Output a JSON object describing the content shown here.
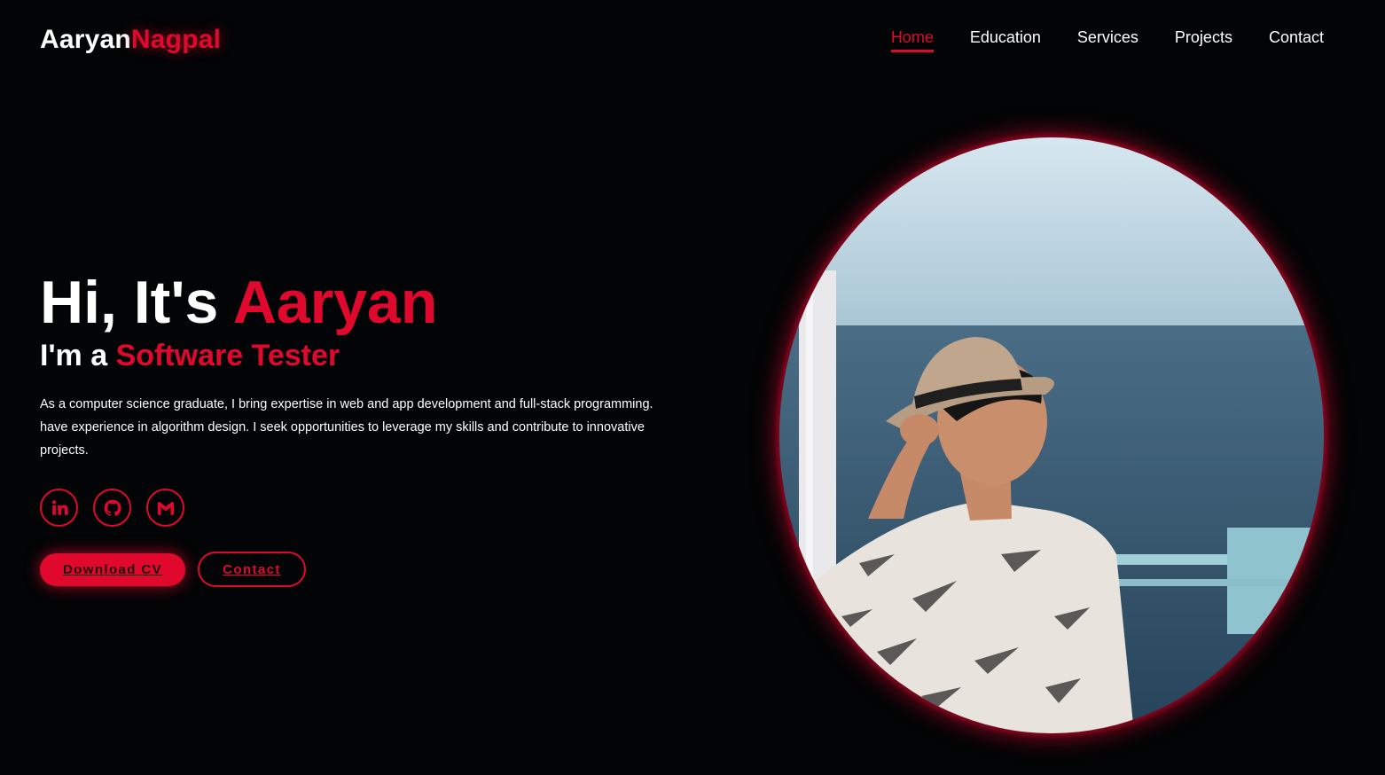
{
  "header": {
    "logo_first": "Aaryan",
    "logo_last": "Nagpal",
    "nav": [
      {
        "label": "Home",
        "active": true
      },
      {
        "label": "Education",
        "active": false
      },
      {
        "label": "Services",
        "active": false
      },
      {
        "label": "Projects",
        "active": false
      },
      {
        "label": "Contact",
        "active": false
      }
    ]
  },
  "hero": {
    "greeting": "Hi, It's ",
    "name": "Aaryan",
    "role_prefix": "I'm a ",
    "role": "Software Tester",
    "description": "As a computer science graduate, I bring expertise in web and app development and full-stack programming. have experience in algorithm design. I seek opportunities to leverage my skills and contribute to innovative projects.",
    "socials": [
      {
        "icon": "linkedin-icon"
      },
      {
        "icon": "github-icon"
      },
      {
        "icon": "gmail-icon"
      }
    ],
    "primary_button": "Download CV",
    "secondary_button": "Contact"
  },
  "photo": {
    "icon": "profile-photo"
  },
  "colors": {
    "accent": "#e0082d",
    "background": "#020405",
    "text": "#ffffff"
  }
}
